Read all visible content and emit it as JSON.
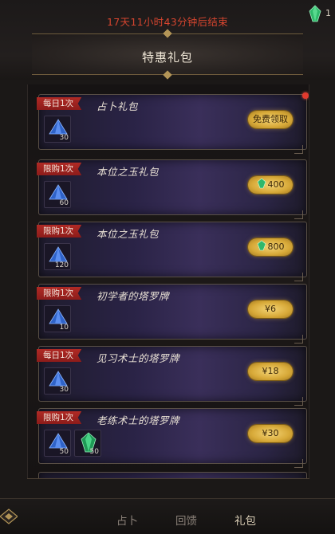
{
  "header": {
    "countdown": "17天11小时43分钟后结束",
    "title": "特惠礼包",
    "currency_amount": "1"
  },
  "cards": [
    {
      "tag": "每日1次",
      "title": "占卜礼包",
      "items": [
        {
          "icon": "blue-crystal-icon",
          "qty": "30"
        }
      ],
      "button": "免费领取",
      "button_icon": "",
      "notify": true
    },
    {
      "tag": "限购1次",
      "title": "本位之玉礼包",
      "items": [
        {
          "icon": "blue-crystal-icon",
          "qty": "60"
        }
      ],
      "button": "400",
      "button_icon": "green-gem-icon"
    },
    {
      "tag": "限购1次",
      "title": "本位之玉礼包",
      "items": [
        {
          "icon": "blue-crystal-icon",
          "qty": "120"
        }
      ],
      "button": "800",
      "button_icon": "green-gem-icon"
    },
    {
      "tag": "限购1次",
      "title": "初学者的塔罗牌",
      "items": [
        {
          "icon": "blue-crystal-icon",
          "qty": "10"
        }
      ],
      "button": "¥6",
      "button_icon": ""
    },
    {
      "tag": "每日1次",
      "title": "见习术士的塔罗牌",
      "items": [
        {
          "icon": "blue-crystal-icon",
          "qty": "30"
        }
      ],
      "button": "¥18",
      "button_icon": ""
    },
    {
      "tag": "限购1次",
      "title": "老练术士的塔罗牌",
      "items": [
        {
          "icon": "blue-crystal-icon",
          "qty": "50"
        },
        {
          "icon": "green-gem-icon",
          "qty": "50"
        }
      ],
      "button": "¥30",
      "button_icon": ""
    }
  ],
  "nav": {
    "tabs": [
      "占卜",
      "回馈",
      "礼包"
    ],
    "active": "礼包"
  },
  "colors": {
    "countdown": "#d6452f",
    "tag": "#a8251f",
    "button": "#e3b64a",
    "card_bg": "#2a2346"
  }
}
